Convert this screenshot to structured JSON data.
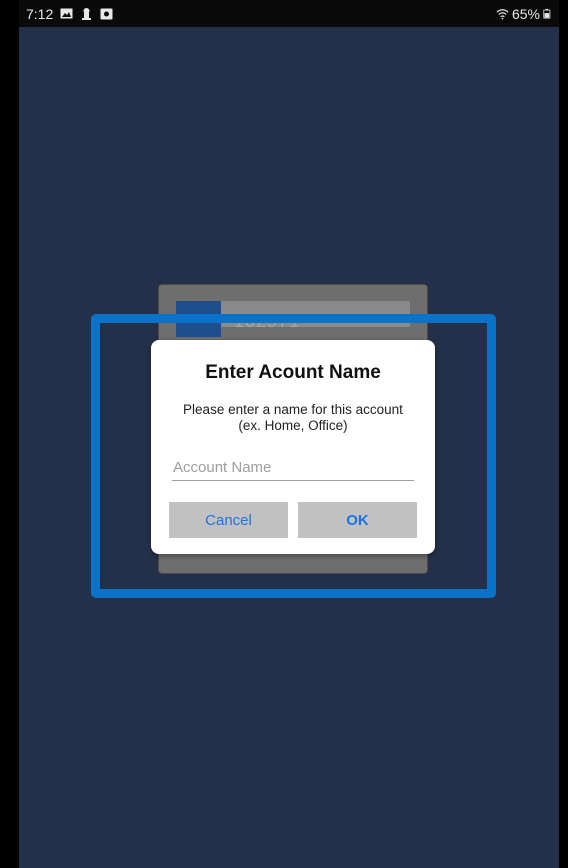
{
  "status_bar": {
    "time": "7:12",
    "battery": "65%",
    "icons_left": [
      "image-icon",
      "keyhole-icon",
      "camera-icon"
    ],
    "icons_right": [
      "wifi-icon",
      "battery-icon"
    ]
  },
  "background_card": {
    "number": "102971"
  },
  "dialog": {
    "title": "Enter Acount Name",
    "message_line1": "Please enter a name for this account",
    "message_line2": "(ex. Home, Office)",
    "input_placeholder": "Account Name",
    "input_value": "",
    "cancel_label": "Cancel",
    "ok_label": "OK"
  },
  "colors": {
    "screen_background": "#24304a",
    "highlight": "#0a72c8",
    "button_text": "#1a73e8",
    "button_background": "#c1c1c1"
  }
}
